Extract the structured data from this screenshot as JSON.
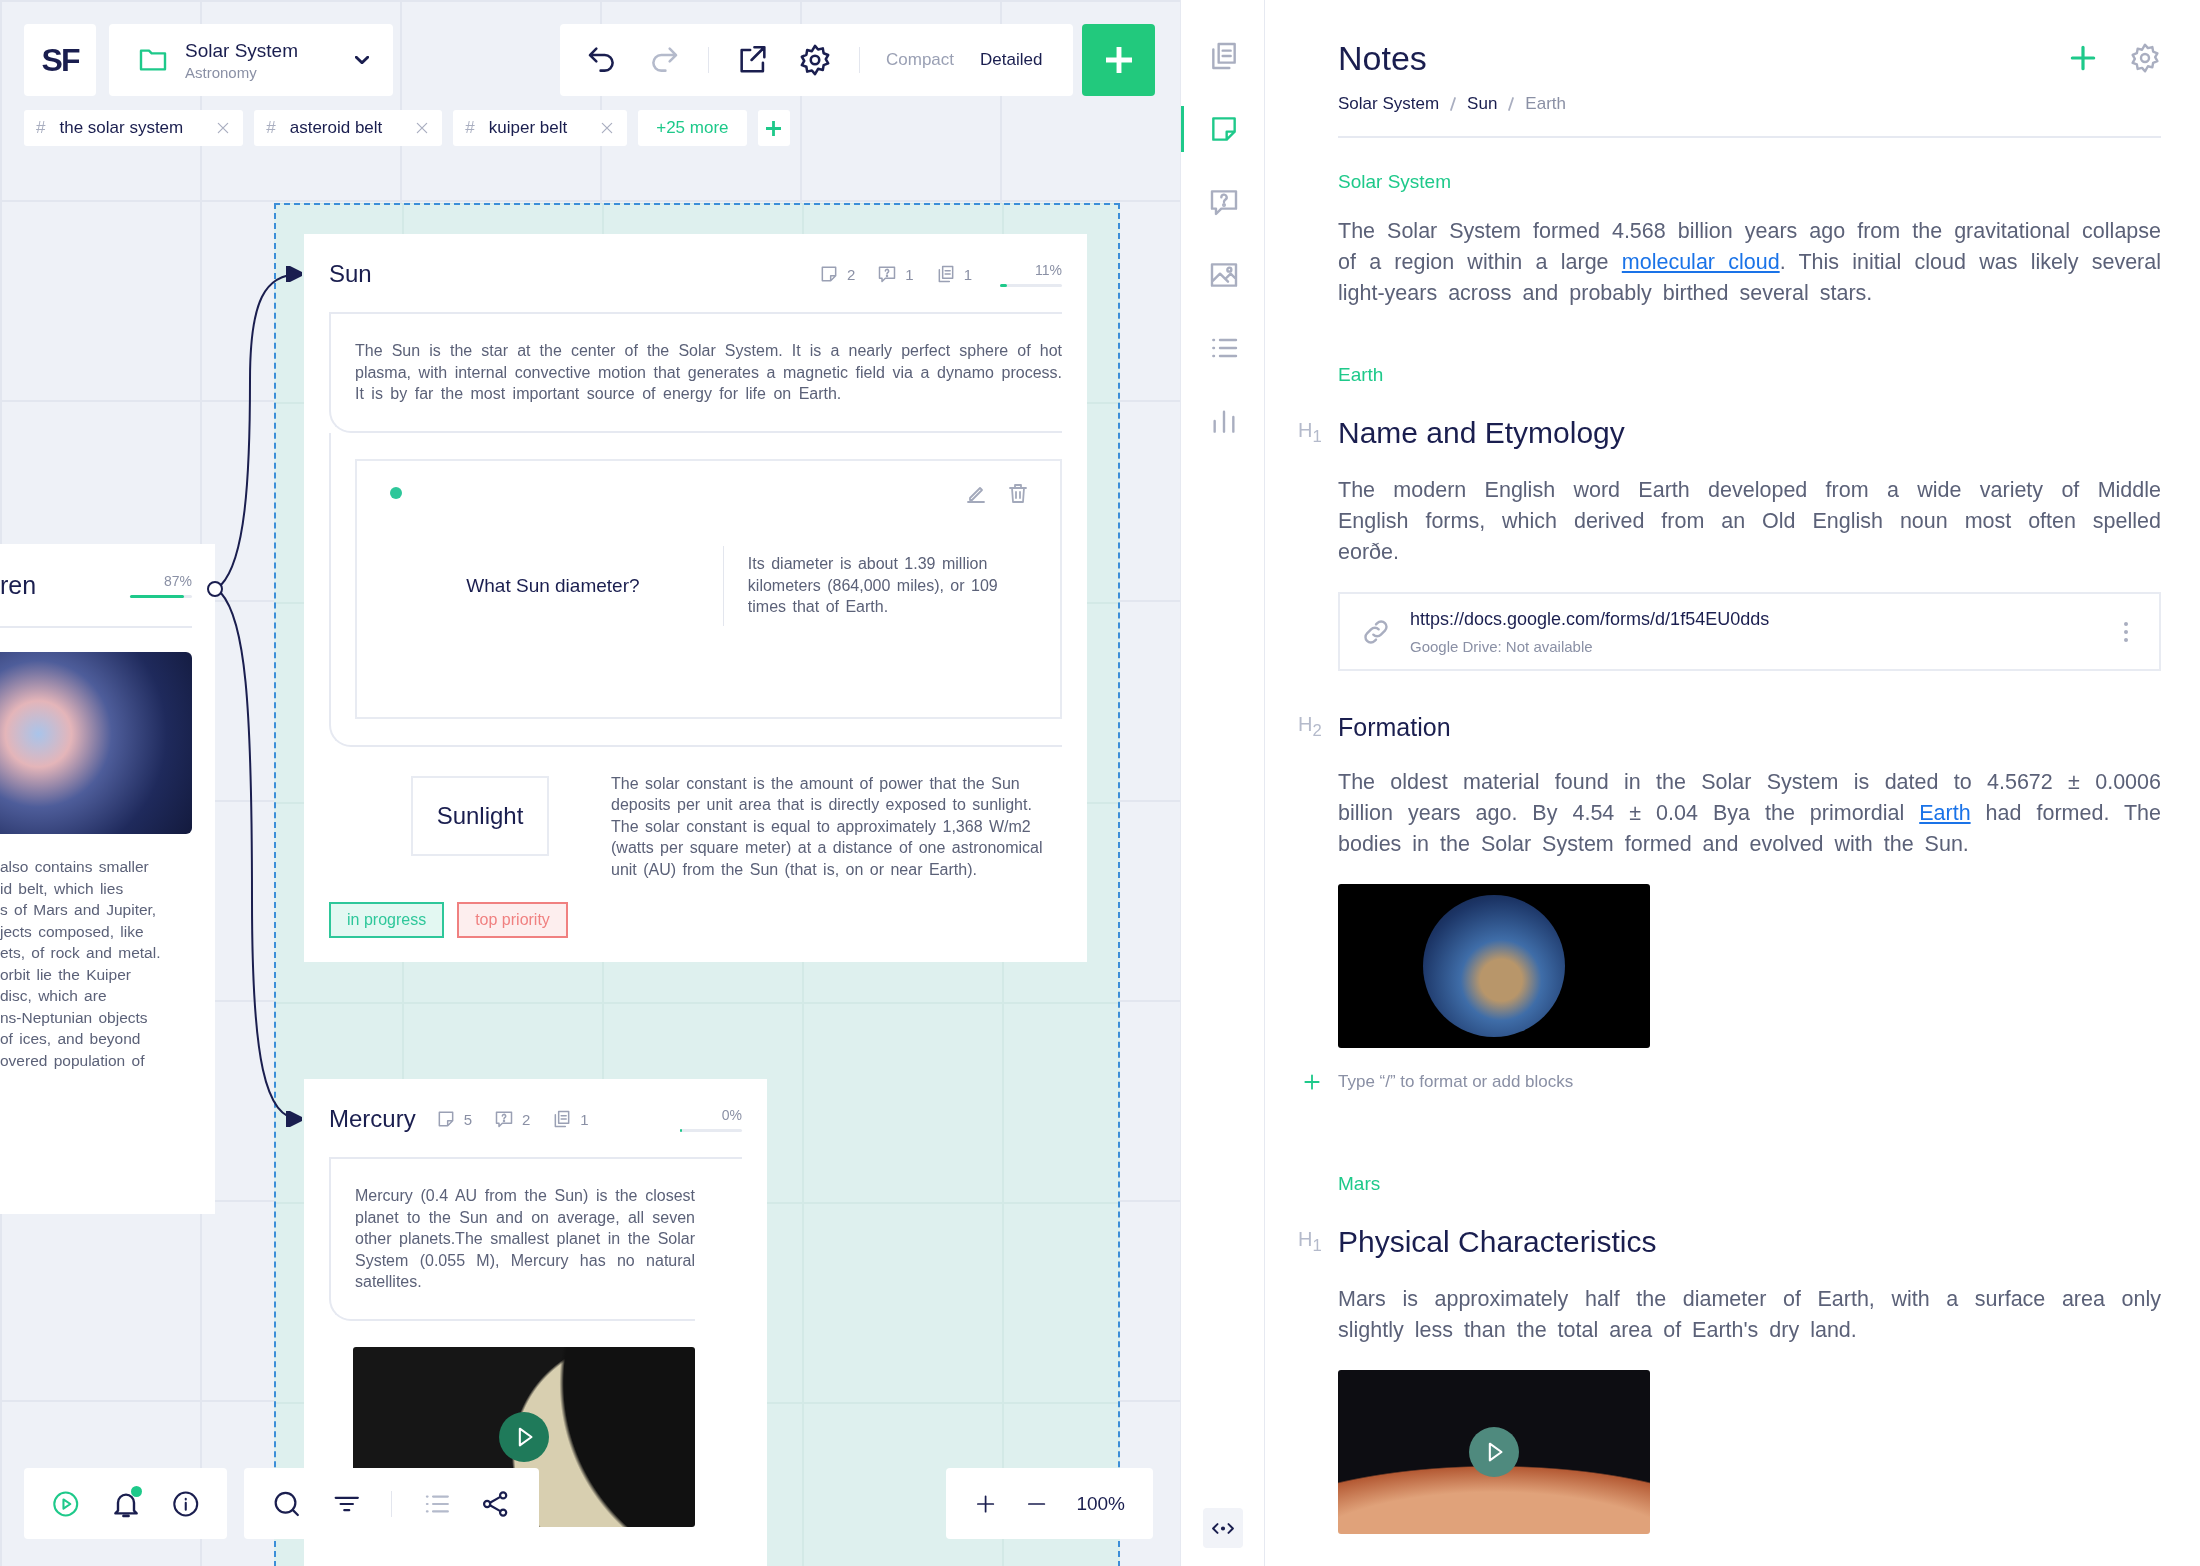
{
  "header": {
    "logo": "SF",
    "project": {
      "name": "Solar System",
      "subtitle": "Astronomy"
    },
    "undo": {
      "disabled": false
    },
    "redo": {
      "disabled": true
    },
    "view_modes": [
      {
        "label": "Compact",
        "selected": false
      },
      {
        "label": "Detailed",
        "selected": true
      }
    ]
  },
  "tags": {
    "items": [
      {
        "prefix": "#",
        "label": "the solar system"
      },
      {
        "prefix": "#",
        "label": "asteroid belt"
      },
      {
        "prefix": "#",
        "label": "kuiper belt"
      }
    ],
    "more": "+25 more"
  },
  "canvas": {
    "side_card": {
      "title": "ren",
      "level": 0.87,
      "reading": "87%",
      "text": "also contains smaller\nid belt, which lies\ns of Mars and Jupiter,\njects composed, like\nets, of rock and metal.\norbit lie the Kuiper\ndisc, which are\nns-Neptunian objects\nof ices, and beyond\novered population of"
    },
    "topic_cards": [
      {
        "title": "Sun",
        "notes": "2",
        "questions": "1",
        "copies": "1",
        "level": 0.11,
        "reading": "11%",
        "blocks": [
          {
            "kind": "text",
            "text": "The Sun is the star at the center of the Solar System. It is a nearly perfect sphere of hot plasma, with internal convective motion that generates a magnetic field via a dynamo process. It is by far the most important source of energy for life on Earth."
          },
          {
            "kind": "flashcard",
            "question": "What Sun diameter?",
            "answer": "Its diameter is about 1.39 million kilometers (864,000 miles), or 109 times that of Earth."
          },
          {
            "kind": "branch",
            "label": "Sunlight",
            "text": "The solar constant is the amount of power that the Sun deposits per unit area that is directly exposed to sunlight. The solar constant is equal to approximately 1,368 W/m2 (watts per square meter) at a distance of one astronomical unit (AU) from the Sun (that is, on or near Earth)."
          }
        ],
        "labels": [
          {
            "label": "in progress",
            "color": "#2ec79a"
          },
          {
            "label": "top priority",
            "color": "#f08080"
          }
        ]
      },
      {
        "title": "Mercury",
        "notes": "5",
        "questions": "2",
        "copies": "1",
        "level": 0,
        "reading": "0%",
        "blocks": [
          {
            "kind": "text",
            "text": "Mercury (0.4 AU from the Sun) is the closest planet to the Sun and on average, all seven other planets.The smallest planet in the Solar System (0.055 M), Mercury has no natural satellites."
          },
          {
            "kind": "video"
          }
        ]
      }
    ]
  },
  "bottom_tools": {
    "unread": true
  },
  "zoom": {
    "reading": "100%"
  },
  "rail": [
    {
      "kind": "document",
      "selected": false
    },
    {
      "kind": "note",
      "selected": true
    },
    {
      "kind": "question",
      "selected": false
    },
    {
      "kind": "image",
      "selected": false
    },
    {
      "kind": "list",
      "selected": false
    },
    {
      "kind": "chart",
      "selected": false
    }
  ],
  "notes": {
    "title": "Notes",
    "breadcrumbs": [
      {
        "label": "Solar System",
        "current": false
      },
      {
        "label": "Sun",
        "current": false
      },
      {
        "label": "Earth",
        "current": true
      }
    ],
    "blocks": [
      {
        "kind": "section",
        "text": "Solar System"
      },
      {
        "kind": "paragraph",
        "parts": [
          {
            "text": "The Solar System formed 4.568 billion years ago from the gravitational collapse of a region within a large ",
            "link": false
          },
          {
            "text": "molecular cloud",
            "link": true
          },
          {
            "text": ". This initial cloud was likely several light-years across and probably birthed several stars.",
            "link": false
          }
        ]
      },
      {
        "kind": "section",
        "text": "Earth"
      },
      {
        "kind": "heading",
        "marker": "H$_{1}$",
        "text": "Name and Etymology"
      },
      {
        "kind": "paragraph",
        "parts": [
          {
            "text": "The modern English word Earth developed from a wide variety of Middle English forms, which derived from an Old English noun most often spelled eorðe.",
            "link": false
          }
        ]
      },
      {
        "kind": "link_card",
        "url": "https://docs.google.com/forms/d/1f54EU0dds",
        "status": "Google Drive: Not available"
      },
      {
        "kind": "heading",
        "marker": "H$_{2}$",
        "text": "Formation"
      },
      {
        "kind": "paragraph",
        "parts": [
          {
            "text": "The oldest material found in the Solar System is dated to 4.5672 ± 0.0006 billion years ago. By 4.54 ± 0.04 Bya the primordial ",
            "link": false
          },
          {
            "text": "Earth",
            "link": true
          },
          {
            "text": " had formed. The bodies in the Solar System formed and evolved with the Sun.",
            "link": false
          }
        ]
      },
      {
        "kind": "photo"
      },
      {
        "kind": "add_block",
        "placeholder": "Type “/” to format or add blocks"
      },
      {
        "kind": "section",
        "text": "Mars"
      },
      {
        "kind": "heading",
        "marker": "H$_{1}$",
        "text": "Physical Characteristics"
      },
      {
        "kind": "paragraph",
        "parts": [
          {
            "text": "Mars is approximately half the diameter of Earth, with a surface area only slightly less than the total area of Earth's dry land.",
            "link": false
          }
        ]
      },
      {
        "kind": "video"
      }
    ]
  }
}
